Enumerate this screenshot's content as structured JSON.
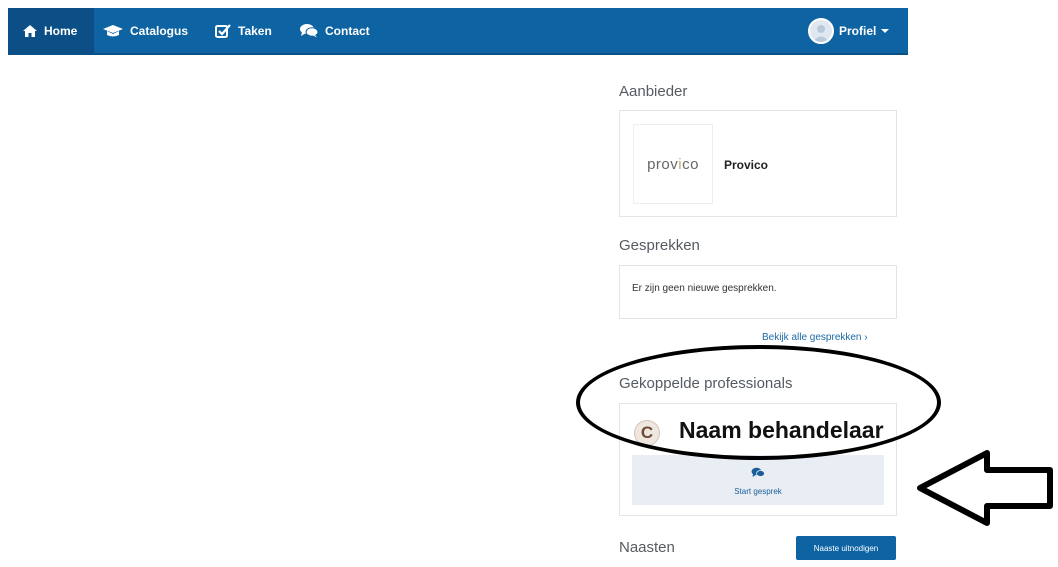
{
  "nav": {
    "home": "Home",
    "catalogus": "Catalogus",
    "taken": "Taken",
    "contact": "Contact",
    "profile": "Profiel"
  },
  "aanbieder": {
    "heading": "Aanbieder",
    "logo_text_a": "prov",
    "logo_text_b": "i",
    "logo_text_c": "co",
    "name": "Provico"
  },
  "gesprekken": {
    "heading": "Gesprekken",
    "empty_message": "Er zijn geen nieuwe gesprekken.",
    "view_all": "Bekijk alle gesprekken ›"
  },
  "professionals": {
    "heading": "Gekoppelde professionals",
    "items": [
      {
        "avatar_letter": "C",
        "name": "Naam behandelaar",
        "action_label": "Start gesprek"
      }
    ]
  },
  "naasten": {
    "heading": "Naasten",
    "invite_button": "Naaste uitnodigen"
  },
  "colors": {
    "navbar": "#0e63a3",
    "navbar_active": "#0b4f86",
    "link": "#1a6aa6"
  }
}
